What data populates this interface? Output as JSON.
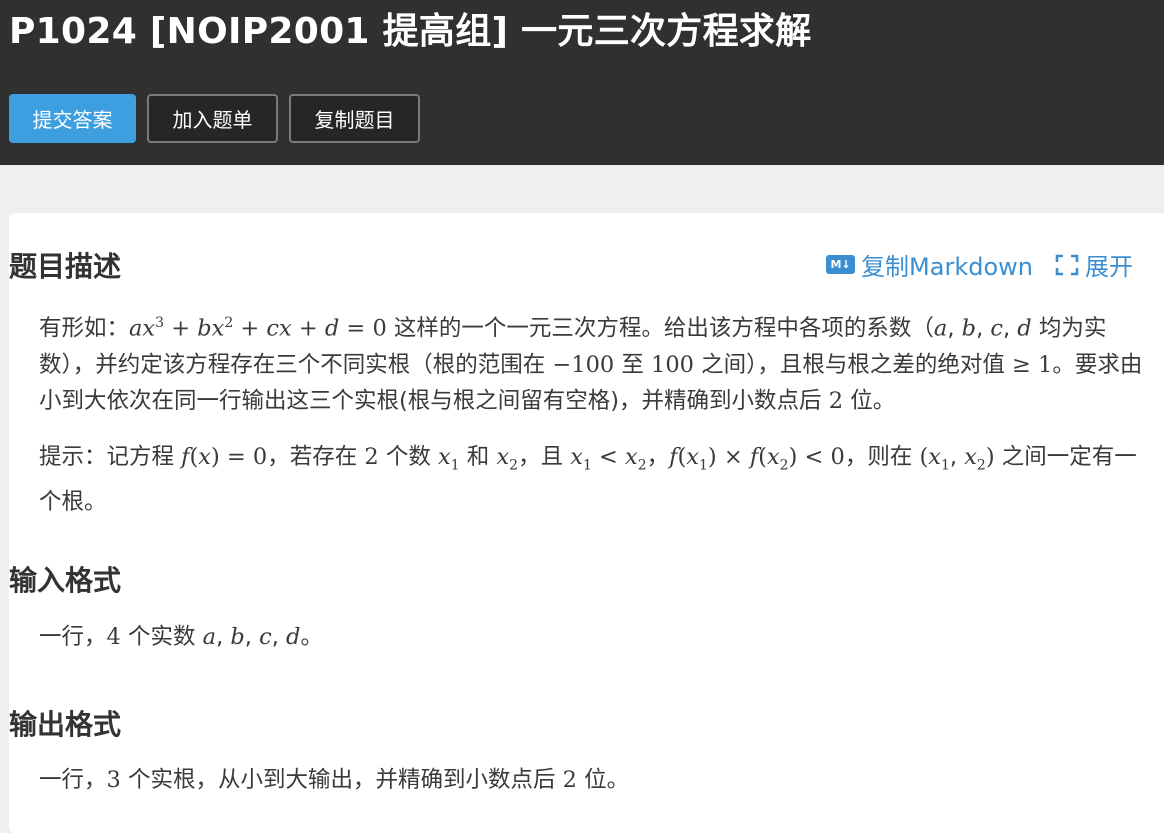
{
  "header": {
    "title": "P1024 [NOIP2001 提高组] 一元三次方程求解",
    "buttons": {
      "submit": "提交答案",
      "add_list": "加入题单",
      "copy": "复制题目"
    }
  },
  "card": {
    "tools": {
      "md_icon": "M↓",
      "copy_markdown": "复制Markdown",
      "expand": "展开"
    },
    "description": {
      "heading": "题目描述",
      "p1": {
        "a": "有形如：",
        "b": " 这样的一个一元三次方程。给出该方程中各项的系数（",
        "c": " 均为实数），并约定该方程存在三个不同实根（根的范围在 ",
        "d": " 至 ",
        "e": " 之间），且根与根之差的绝对值 ",
        "f": "。要求由小到大依次在同一行输出这三个实根(根与根之间留有空格)，并精确到小数点后 ",
        "g": " 位。"
      },
      "p2": {
        "a": "提示：记方程 ",
        "b": "，若存在 ",
        "c": " 个数 ",
        "d": " 和 ",
        "e": "，且 ",
        "f": "，",
        "g": "，则在 ",
        "h": " 之间一定有一个根。"
      }
    },
    "input": {
      "heading": "输入格式",
      "a": "一行，",
      "b": " 个实数 ",
      "c": "。"
    },
    "output": {
      "heading": "输出格式",
      "a": "一行，",
      "b": " 个实根，从小到大输出，并精确到小数点后 ",
      "c": " 位。"
    }
  }
}
